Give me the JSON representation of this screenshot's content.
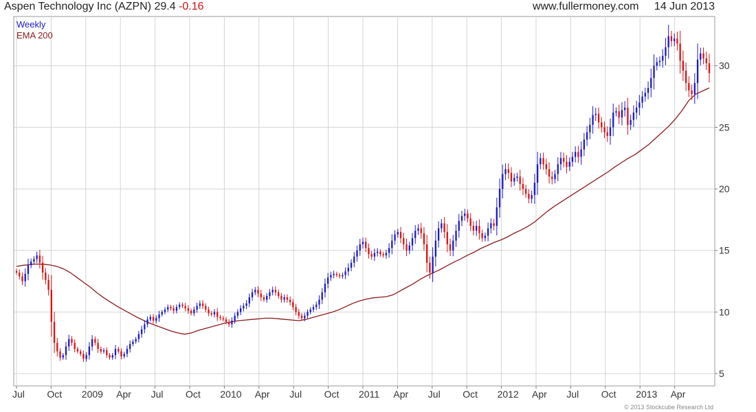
{
  "header": {
    "title": "Aspen Technology Inc (AZPN)",
    "last": "29.4",
    "change": "-0.16",
    "site": "www.fullermoney.com",
    "date": "14 Jun 2013"
  },
  "footer": {
    "copyright": "© 2013 Stockcube Research Ltd"
  },
  "chart_data": {
    "type": "candlestick",
    "frequency": "Weekly",
    "ylim": [
      4,
      34
    ],
    "y_ticks": [
      5,
      10,
      15,
      20,
      25,
      30
    ],
    "x_tick_labels": [
      "Jul",
      "Oct",
      "2009",
      "Apr",
      "Jul",
      "Oct",
      "2010",
      "Apr",
      "Jul",
      "Oct",
      "2011",
      "Apr",
      "Jul",
      "Oct",
      "2012",
      "Apr",
      "Jul",
      "Oct",
      "2013",
      "Apr"
    ],
    "grid": true,
    "legend": {
      "position": "top-left",
      "entries": [
        {
          "name": "Weekly",
          "color": "#1a1acc"
        },
        {
          "name": "EMA 200",
          "color": "#8b1a1a"
        }
      ]
    },
    "colors": {
      "up": "#1a1acc",
      "down": "#dd1111",
      "ema": "#8b1a1a",
      "grid": "#d4d4d4"
    },
    "weekly_close": [
      13.2,
      12.9,
      12.5,
      13.1,
      13.8,
      14.1,
      14.3,
      14.6,
      14.0,
      13.2,
      12.6,
      11.8,
      9.2,
      7.5,
      6.8,
      6.3,
      6.5,
      7.2,
      7.8,
      7.5,
      7.0,
      6.8,
      6.6,
      6.2,
      6.5,
      7.2,
      7.8,
      7.5,
      7.0,
      6.8,
      6.9,
      6.5,
      6.3,
      6.5,
      7.0,
      6.8,
      6.4,
      6.6,
      7.0,
      7.4,
      7.6,
      7.8,
      8.2,
      8.6,
      9.0,
      9.4,
      9.6,
      9.3,
      9.5,
      9.8,
      10.0,
      10.2,
      10.4,
      10.3,
      10.1,
      10.4,
      10.6,
      10.5,
      10.3,
      10.1,
      9.9,
      10.2,
      10.5,
      10.7,
      10.5,
      10.2,
      9.9,
      9.8,
      10.0,
      9.6,
      9.5,
      9.4,
      9.2,
      9.0,
      9.3,
      9.7,
      10.0,
      10.3,
      10.5,
      10.7,
      11.2,
      11.6,
      11.8,
      11.5,
      11.2,
      11.0,
      11.3,
      11.6,
      11.8,
      11.6,
      11.3,
      11.0,
      11.2,
      11.0,
      10.8,
      10.4,
      10.0,
      9.7,
      9.5,
      9.7,
      10.0,
      10.2,
      10.4,
      10.6,
      11.0,
      11.6,
      12.3,
      12.8,
      13.0,
      13.1,
      13.0,
      12.9,
      13.0,
      13.3,
      13.6,
      14.0,
      14.5,
      15.0,
      15.5,
      15.7,
      15.2,
      14.7,
      14.5,
      14.8,
      14.9,
      14.7,
      14.6,
      14.8,
      15.2,
      15.8,
      16.3,
      16.5,
      16.0,
      15.5,
      15.0,
      15.4,
      16.0,
      16.6,
      16.8,
      16.4,
      15.5,
      14.0,
      13.2,
      14.5,
      15.8,
      16.8,
      17.2,
      16.5,
      15.5,
      15.0,
      15.8,
      16.6,
      17.4,
      17.8,
      18.0,
      17.6,
      17.0,
      16.6,
      17.0,
      16.4,
      16.0,
      16.2,
      16.8,
      17.2,
      17.0,
      18.5,
      20.0,
      21.2,
      21.6,
      21.3,
      20.6,
      20.9,
      21.0,
      20.4,
      20.0,
      19.6,
      19.2,
      19.5,
      20.5,
      22.0,
      22.5,
      22.0,
      21.6,
      21.0,
      20.8,
      21.2,
      22.0,
      22.5,
      22.2,
      21.8,
      22.2,
      22.6,
      23.0,
      22.6,
      23.2,
      24.0,
      24.6,
      25.2,
      26.0,
      26.1,
      25.4,
      25.0,
      24.6,
      24.3,
      25.0,
      26.2,
      26.3,
      25.8,
      26.4,
      26.6,
      25.2,
      25.6,
      26.2,
      26.6,
      27.0,
      27.5,
      27.8,
      28.2,
      29.0,
      30.0,
      30.3,
      30.4,
      30.8,
      31.5,
      32.4,
      32.0,
      32.2,
      31.8,
      30.4,
      29.6,
      28.6,
      28.0,
      27.7,
      28.6,
      30.5,
      31.0,
      30.6,
      30.2,
      29.4
    ],
    "ema_200": [
      13.7,
      13.8,
      13.85,
      13.9,
      13.88,
      13.82,
      13.7,
      13.5,
      13.2,
      12.8,
      12.4,
      12.0,
      11.55,
      11.15,
      10.8,
      10.45,
      10.15,
      9.85,
      9.55,
      9.3,
      9.05,
      8.85,
      8.65,
      8.45,
      8.3,
      8.2,
      8.3,
      8.5,
      8.65,
      8.8,
      8.95,
      9.1,
      9.2,
      9.3,
      9.35,
      9.4,
      9.45,
      9.5,
      9.5,
      9.45,
      9.4,
      9.35,
      9.3,
      9.4,
      9.55,
      9.7,
      9.85,
      10.0,
      10.2,
      10.45,
      10.7,
      10.9,
      11.05,
      11.15,
      11.2,
      11.25,
      11.4,
      11.7,
      12.0,
      12.3,
      12.65,
      12.95,
      13.2,
      13.45,
      13.75,
      14.05,
      14.3,
      14.6,
      14.85,
      15.15,
      15.4,
      15.65,
      15.85,
      16.1,
      16.4,
      16.65,
      16.95,
      17.3,
      17.75,
      18.2,
      18.6,
      18.95,
      19.3,
      19.65,
      20.0,
      20.35,
      20.7,
      21.05,
      21.4,
      21.8,
      22.15,
      22.5,
      22.8,
      23.2,
      23.6,
      24.1,
      24.6,
      25.1,
      25.7,
      26.4,
      27.2,
      27.7,
      27.95,
      28.2
    ]
  }
}
